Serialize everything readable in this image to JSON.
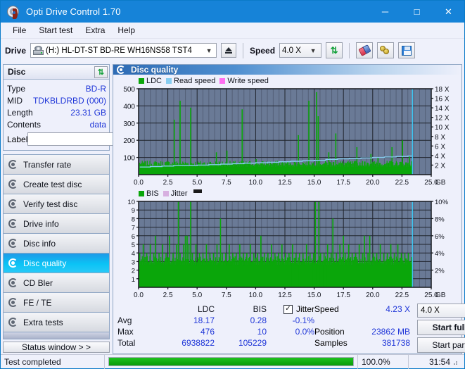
{
  "window": {
    "title": "Opti Drive Control 1.70",
    "icon": "disc-icon",
    "minimize": "─",
    "maximize": "□",
    "close": "✕"
  },
  "menu": {
    "items": [
      "File",
      "Start test",
      "Extra",
      "Help"
    ]
  },
  "toolbar": {
    "drive_label": "Drive",
    "drive_value": "(H:)  HL-DT-ST BD-RE  WH16NS58 TST4",
    "eject_title": "Eject",
    "speed_label": "Speed",
    "speed_value": "4.0 X",
    "refresh_icon": "refresh-icon",
    "erase_icon": "eraser-icon",
    "keys_icon": "keys-icon",
    "save_icon": "save-icon"
  },
  "disc_panel": {
    "header": "Disc",
    "refresh_icon": "refresh-icon",
    "rows": [
      {
        "key": "Type",
        "value": "BD-R"
      },
      {
        "key": "MID",
        "value": "TDKBLDRBD (000)"
      },
      {
        "key": "Length",
        "value": "23.31 GB"
      },
      {
        "key": "Contents",
        "value": "data"
      }
    ],
    "label_key": "Label",
    "label_value": "",
    "label_placeholder": ""
  },
  "nav": {
    "items": [
      {
        "label": "Transfer rate",
        "selected": false
      },
      {
        "label": "Create test disc",
        "selected": false
      },
      {
        "label": "Verify test disc",
        "selected": false
      },
      {
        "label": "Drive info",
        "selected": false
      },
      {
        "label": "Disc info",
        "selected": false
      },
      {
        "label": "Disc quality",
        "selected": true
      },
      {
        "label": "CD Bler",
        "selected": false
      },
      {
        "label": "FE / TE",
        "selected": false
      },
      {
        "label": "Extra tests",
        "selected": false
      }
    ],
    "status_window": "Status window > >"
  },
  "main": {
    "header": "Disc quality",
    "header_icon": "disc-quality-icon"
  },
  "chart_data": [
    {
      "type": "bar",
      "id": "ldc-chart",
      "title": "",
      "legend": [
        {
          "label": "LDC",
          "color": "#0aa60a"
        },
        {
          "label": "Read speed",
          "color": "#87cdf0"
        },
        {
          "label": "Write speed",
          "color": "#ff6ef0"
        }
      ],
      "legend_position": "top-left",
      "xlabel": "GB",
      "x_ticks": [
        "0.0",
        "2.5",
        "5.0",
        "7.5",
        "10.0",
        "12.5",
        "15.0",
        "17.5",
        "20.0",
        "22.5",
        "25.0"
      ],
      "xlim": [
        0,
        25
      ],
      "ylabel_left": "LDC",
      "y_ticks_left": [
        "100",
        "200",
        "300",
        "400",
        "500"
      ],
      "ylim_left": [
        0,
        500
      ],
      "ylabel_right": "Speed",
      "y_ticks_right": [
        "2 X",
        "4 X",
        "6 X",
        "8 X",
        "10 X",
        "12 X",
        "14 X",
        "16 X",
        "18 X"
      ],
      "ylim_right": [
        0,
        18
      ],
      "grid": true,
      "plot_bg": "#6a7a96",
      "data_end_gb": 23.4,
      "baseline_value": 45,
      "series": [
        {
          "name": "LDC",
          "color": "#0aa60a",
          "x": [
            0.1,
            0.3,
            0.6,
            0.9,
            1.2,
            1.5,
            1.8,
            2.1,
            2.4,
            2.7,
            3.0,
            3.2,
            3.35,
            3.5,
            3.8,
            4.1,
            4.4,
            4.7,
            5.0,
            5.3,
            5.6,
            5.9,
            6.2,
            6.45,
            6.6,
            6.9,
            7.2,
            7.5,
            7.8,
            8.0,
            8.2,
            8.5,
            8.8,
            9.1,
            9.4,
            9.7,
            10.0,
            10.3,
            10.6,
            10.9,
            11.2,
            11.5,
            11.8,
            12.1,
            12.4,
            12.7,
            13.0,
            13.3,
            13.6,
            13.9,
            14.2,
            14.5,
            14.8,
            15.0,
            15.15,
            15.3,
            15.6,
            15.9,
            16.2,
            16.5,
            16.8,
            17.1,
            17.4,
            17.7,
            18.0,
            18.3,
            18.6,
            18.9,
            19.2,
            19.5,
            19.8,
            20.1,
            20.4,
            20.7,
            21.0,
            21.3,
            21.6,
            21.9,
            22.2,
            22.5,
            22.8,
            23.1,
            23.3
          ],
          "values": [
            60,
            55,
            50,
            48,
            52,
            50,
            48,
            46,
            50,
            48,
            320,
            55,
            50,
            430,
            52,
            50,
            390,
            48,
            52,
            50,
            48,
            46,
            50,
            48,
            130,
            50,
            48,
            140,
            50,
            48,
            52,
            50,
            380,
            48,
            52,
            50,
            90,
            48,
            52,
            50,
            48,
            46,
            50,
            48,
            52,
            50,
            48,
            46,
            230,
            48,
            52,
            430,
            50,
            50,
            480,
            340,
            52,
            50,
            130,
            48,
            240,
            50,
            48,
            46,
            50,
            48,
            160,
            50,
            48,
            70,
            120,
            50,
            100,
            48,
            52,
            50,
            160,
            48,
            52,
            200,
            48,
            110,
            60
          ]
        },
        {
          "name": "Read speed",
          "color": "#87cdf0",
          "x": [
            0.1,
            1.0,
            2.0,
            3.0,
            4.0,
            5.0,
            6.0,
            7.0,
            8.0,
            9.0,
            10.0,
            11.0,
            12.0,
            13.0,
            14.0,
            15.0,
            16.0,
            17.0,
            18.0,
            19.0,
            20.0,
            21.0,
            22.0,
            23.0,
            23.4
          ],
          "values": [
            1.6,
            1.7,
            1.8,
            1.9,
            1.9,
            2.0,
            2.1,
            2.2,
            2.3,
            2.4,
            2.5,
            2.6,
            2.7,
            2.8,
            2.9,
            3.0,
            3.2,
            3.3,
            3.4,
            3.5,
            3.6,
            3.7,
            3.8,
            3.9,
            3.9
          ]
        },
        {
          "name": "Write speed",
          "color": "#ff6ef0",
          "x": [],
          "values": []
        }
      ]
    },
    {
      "type": "bar",
      "id": "bis-chart",
      "title": "",
      "legend": [
        {
          "label": "BIS",
          "color": "#0aa60a"
        },
        {
          "label": "Jitter",
          "color": "#d7b0e0"
        }
      ],
      "legend_position": "top-left",
      "xlabel": "GB",
      "x_ticks": [
        "0.0",
        "2.5",
        "5.0",
        "7.5",
        "10.0",
        "12.5",
        "15.0",
        "17.5",
        "20.0",
        "22.5",
        "25.0"
      ],
      "xlim": [
        0,
        25
      ],
      "ylabel_left": "BIS",
      "y_ticks_left": [
        "1",
        "2",
        "3",
        "4",
        "5",
        "6",
        "7",
        "8",
        "9",
        "10"
      ],
      "ylim_left": [
        0,
        10
      ],
      "ylabel_right": "Jitter",
      "y_ticks_right": [
        "2%",
        "4%",
        "6%",
        "8%",
        "10%"
      ],
      "ylim_right": [
        0,
        10
      ],
      "grid": true,
      "plot_bg": "#6a7a96",
      "data_end_gb": 23.4,
      "baseline_value": 2.6,
      "series": [
        {
          "name": "BIS",
          "color": "#0aa60a",
          "x": [
            0.05,
            0.2,
            0.35,
            0.5,
            0.65,
            0.8,
            0.95,
            1.1,
            1.25,
            1.4,
            1.55,
            1.7,
            1.85,
            2.0,
            2.15,
            2.3,
            2.45,
            2.6,
            2.75,
            2.9,
            3.05,
            3.2,
            3.35,
            3.5,
            3.65,
            3.8,
            3.95,
            4.1,
            4.25,
            4.4,
            4.55,
            4.7,
            4.85,
            5.0,
            5.15,
            5.3,
            5.45,
            5.6,
            5.75,
            5.9,
            6.05,
            6.2,
            6.35,
            6.5,
            6.65,
            6.8,
            6.95,
            7.1,
            7.25,
            7.4,
            7.55,
            7.7,
            7.85,
            8.0,
            8.15,
            8.3,
            8.45,
            8.6,
            8.75,
            8.9,
            9.05,
            9.2,
            9.35,
            9.5,
            9.65,
            9.8,
            9.95,
            10.1,
            10.25,
            10.4,
            10.55,
            10.7,
            10.85,
            11.0,
            11.15,
            11.3,
            11.45,
            11.6,
            11.75,
            11.9,
            12.05,
            12.2,
            12.35,
            12.5,
            12.65,
            12.8,
            12.95,
            13.1,
            13.25,
            13.4,
            13.55,
            13.7,
            13.85,
            14.0,
            14.15,
            14.3,
            14.45,
            14.6,
            14.75,
            14.9,
            15.05,
            15.2,
            15.35,
            15.5,
            15.65,
            15.8,
            15.95,
            16.1,
            16.25,
            16.4,
            16.55,
            16.7,
            16.85,
            17.0,
            17.15,
            17.3,
            17.45,
            17.6,
            17.75,
            17.9,
            18.05,
            18.2,
            18.35,
            18.5,
            18.65,
            18.8,
            18.95,
            19.1,
            19.25,
            19.4,
            19.55,
            19.7,
            19.85,
            20.0,
            20.15,
            20.3,
            20.45,
            20.6,
            20.75,
            20.9,
            21.05,
            21.2,
            21.35,
            21.5,
            21.65,
            21.8,
            21.95,
            22.1,
            22.25,
            22.4,
            22.55,
            22.7,
            22.85,
            23.0,
            23.15,
            23.3
          ],
          "values": [
            4,
            3,
            5,
            3,
            4,
            3,
            5,
            3,
            4,
            6,
            3,
            4,
            3,
            5,
            3,
            4,
            3,
            6,
            3,
            4,
            3,
            5,
            10,
            4,
            3,
            5,
            6,
            6,
            5,
            10,
            4,
            3,
            5,
            3,
            4,
            3,
            4,
            3,
            5,
            3,
            4,
            3,
            4,
            3,
            5,
            3,
            8,
            4,
            3,
            4,
            3,
            5,
            3,
            4,
            3,
            4,
            3,
            5,
            3,
            4,
            3,
            4,
            3,
            5,
            3,
            4,
            3,
            4,
            3,
            6,
            3,
            4,
            3,
            4,
            3,
            5,
            3,
            4,
            3,
            4,
            3,
            5,
            3,
            4,
            3,
            4,
            3,
            5,
            3,
            4,
            3,
            4,
            3,
            4,
            3,
            5,
            3,
            4,
            3,
            4,
            10,
            3,
            10,
            4,
            3,
            4,
            3,
            5,
            3,
            4,
            8,
            3,
            4,
            3,
            5,
            3,
            6,
            4,
            3,
            5,
            3,
            4,
            3,
            4,
            3,
            5,
            3,
            4,
            6,
            3,
            4,
            6,
            3,
            4,
            3,
            4,
            3,
            5,
            3,
            4,
            3,
            4,
            3,
            5,
            3,
            4,
            3,
            5,
            3,
            4,
            3,
            4,
            3,
            4,
            3,
            3,
            3,
            3
          ]
        },
        {
          "name": "Jitter",
          "color": "#d7b0e0",
          "x": [],
          "values": []
        }
      ]
    }
  ],
  "stats": {
    "columns": [
      "LDC",
      "BIS"
    ],
    "jitter_label": "Jitter",
    "jitter_checked": true,
    "rows": [
      {
        "label": "Avg",
        "ldc": "18.17",
        "bis": "0.28",
        "jitter": "-0.1%"
      },
      {
        "label": "Max",
        "ldc": "476",
        "bis": "10",
        "jitter": "0.0%"
      },
      {
        "label": "Total",
        "ldc": "6938822",
        "bis": "105229",
        "jitter": ""
      }
    ]
  },
  "controls": {
    "speed_label": "Speed",
    "speed_value": "4.23 X",
    "position_label": "Position",
    "position_value": "23862 MB",
    "samples_label": "Samples",
    "samples_value": "381738",
    "speed_select": "4.0 X",
    "start_full": "Start full",
    "start_part": "Start part"
  },
  "statusbar": {
    "message": "Test completed",
    "progress_percent": 100.0,
    "progress_text": "100.0%",
    "elapsed": "31:54"
  }
}
